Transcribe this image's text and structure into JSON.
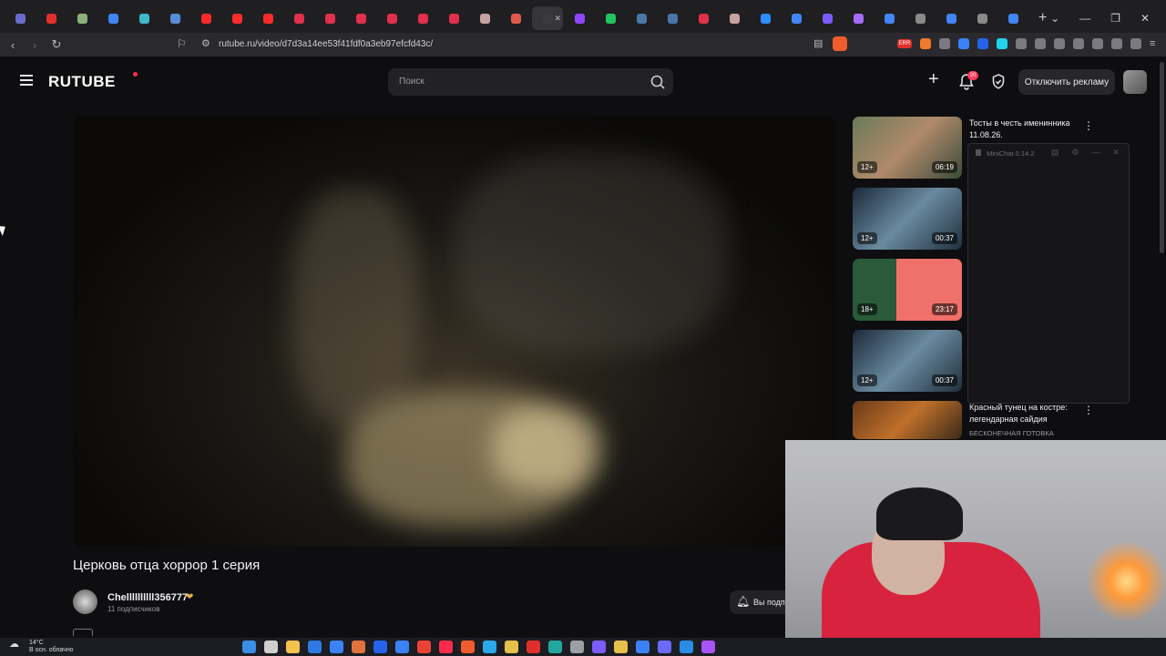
{
  "browser": {
    "tabs": [
      {
        "color": "#6b6bcf"
      },
      {
        "color": "#e0302b"
      },
      {
        "color": "#8ab37a"
      },
      {
        "color": "#4285f4"
      },
      {
        "color": "#3fb9c9"
      },
      {
        "color": "#5a8dd8"
      },
      {
        "color": "#ff2b2b"
      },
      {
        "color": "#ff2b2b"
      },
      {
        "color": "#ff2b2b"
      },
      {
        "color": "#e0304b"
      },
      {
        "color": "#e0304b"
      },
      {
        "color": "#e0304b"
      },
      {
        "color": "#e0304b"
      },
      {
        "color": "#e0304b"
      },
      {
        "color": "#e0304b"
      },
      {
        "color": "#c7a2a2"
      },
      {
        "color": "#e05a4b"
      },
      {
        "color": "#3b3b3b",
        "active": true
      },
      {
        "color": "#9146ff"
      },
      {
        "color": "#22c55e"
      },
      {
        "color": "#4a76a8"
      },
      {
        "color": "#4a76a8"
      },
      {
        "color": "#e0304b"
      },
      {
        "color": "#c7a2a2"
      },
      {
        "color": "#2d8cff"
      },
      {
        "color": "#4285f4"
      },
      {
        "color": "#7a5cff"
      },
      {
        "color": "#a66cff"
      },
      {
        "color": "#4285f4"
      },
      {
        "color": "#8a8a8a"
      },
      {
        "color": "#4285f4"
      },
      {
        "color": "#8a8a8a"
      },
      {
        "color": "#4285f4"
      }
    ],
    "url": "rutube.ru/video/d7d3a14ee53f41fdf0a3eb97efcfd43c/",
    "ext_badge": "ERR"
  },
  "header": {
    "logo": "RUTUBE",
    "search_placeholder": "Поиск",
    "notifications_count": "20",
    "disable_ads": "Отключить рекламу"
  },
  "video": {
    "title": "Церковь отца хоррор 1 серия",
    "channel": "Chellllllllll356777",
    "subscribers": "11 подписчиков",
    "subscribe_label": "Вы подп"
  },
  "recommendations": [
    {
      "title": "Тосты в честь именинника 11.08.26.",
      "channel": "",
      "age": "12+",
      "duration": "06:19"
    },
    {
      "title": "",
      "channel": "",
      "age": "12+",
      "duration": "00:37"
    },
    {
      "title": "",
      "channel": "",
      "age": "18+",
      "duration": "23:17"
    },
    {
      "title": "",
      "channel": "",
      "age": "12+",
      "duration": "00:37"
    },
    {
      "title": "Красный тунец на костре: легендарная сайдия",
      "channel": "БЕСКОНЕЧНАЯ ГОТОВКА",
      "age": "",
      "duration": ""
    }
  ],
  "minichat": {
    "title": "MiniChat 0.14.2"
  },
  "taskbar": {
    "temp": "14°C",
    "weather": "В осн. облачно"
  }
}
